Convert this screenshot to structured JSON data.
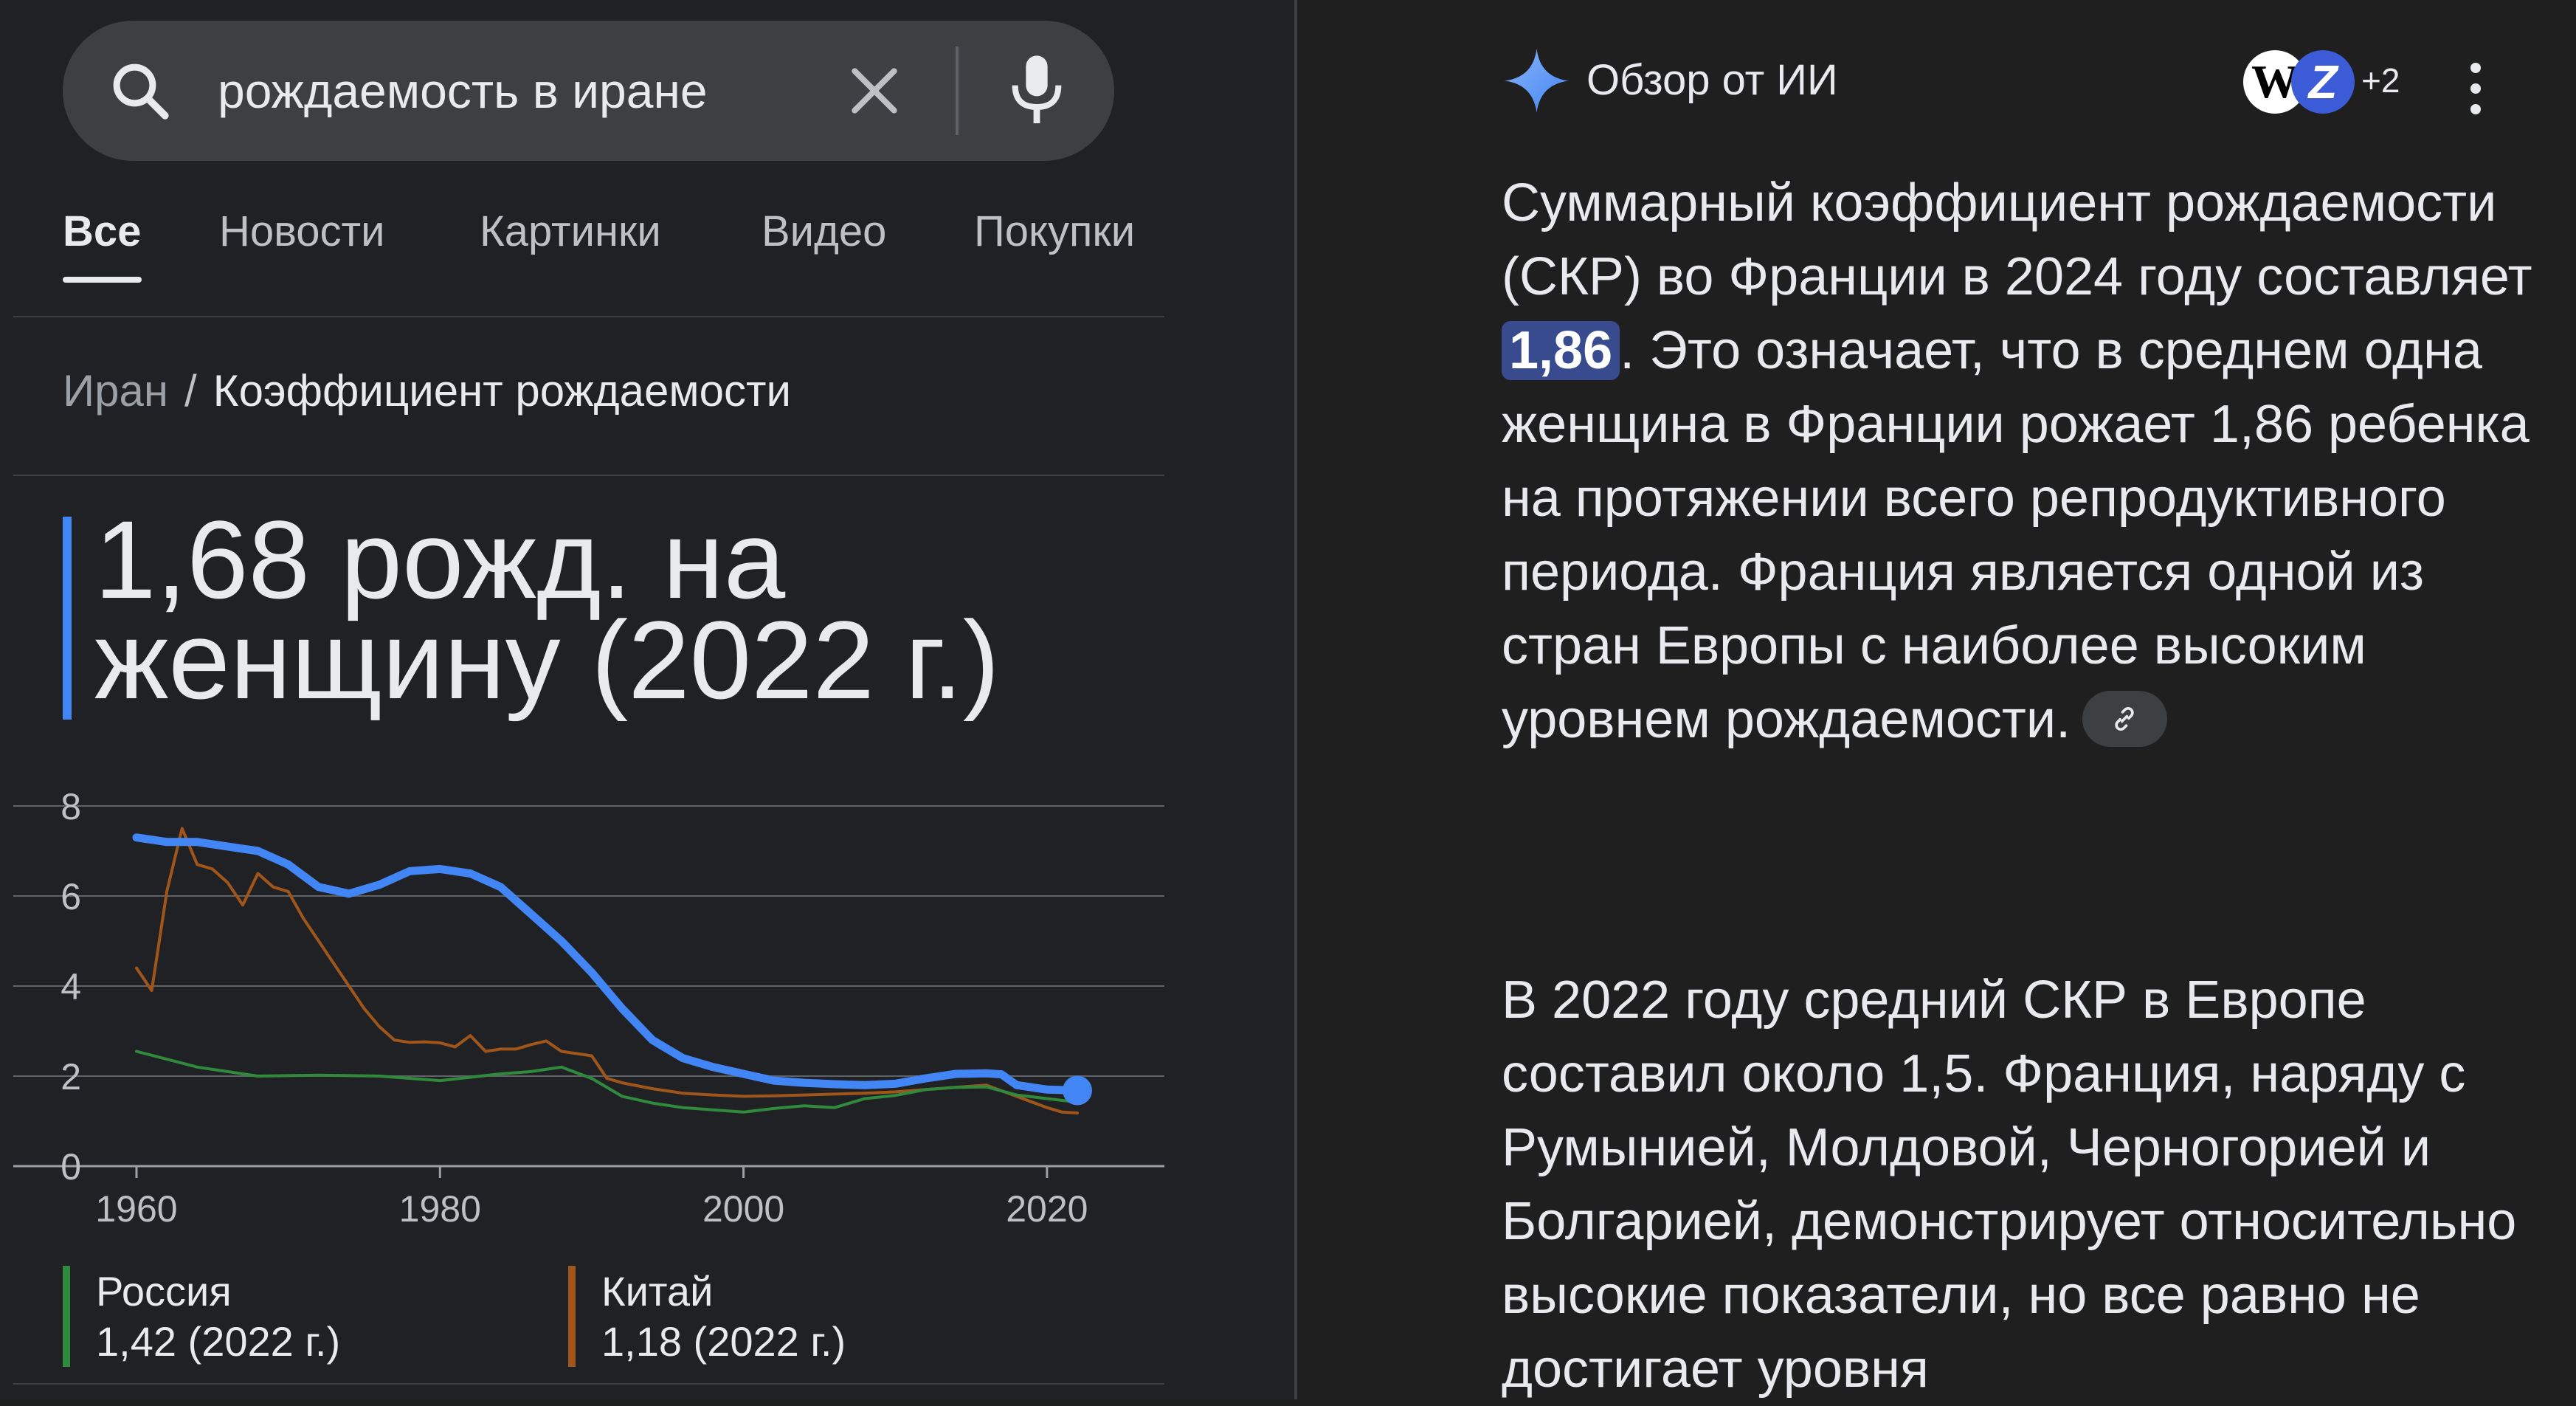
{
  "search": {
    "query": "рождаемость в иране"
  },
  "tabs": [
    "Все",
    "Новости",
    "Картинки",
    "Видео",
    "Покупки"
  ],
  "breadcrumb": {
    "country": "Иран",
    "separator": "/",
    "page": "Коэффициент рождаемости"
  },
  "headline": {
    "value_text": "1,68 рожд. на женщину (2022 г.)"
  },
  "chart_data": {
    "type": "line",
    "x_ticks": [
      "1960",
      "1980",
      "2000",
      "2020"
    ],
    "y_ticks": [
      "0",
      "2",
      "4",
      "6",
      "8"
    ],
    "xlim": [
      1960,
      2022
    ],
    "ylim": [
      0,
      8
    ],
    "grid": true,
    "series": [
      {
        "name": "Иран",
        "color": "#4285f4",
        "highlight": true,
        "x": [
          1960,
          1962,
          1964,
          1966,
          1968,
          1970,
          1972,
          1974,
          1976,
          1978,
          1980,
          1982,
          1984,
          1986,
          1988,
          1990,
          1992,
          1994,
          1996,
          1998,
          2000,
          2002,
          2004,
          2006,
          2008,
          2010,
          2012,
          2014,
          2016,
          2017,
          2018,
          2020,
          2022
        ],
        "y": [
          7.3,
          7.2,
          7.2,
          7.1,
          7.0,
          6.7,
          6.2,
          6.05,
          6.25,
          6.55,
          6.6,
          6.5,
          6.2,
          5.6,
          5.0,
          4.3,
          3.5,
          2.8,
          2.4,
          2.2,
          2.05,
          1.9,
          1.85,
          1.82,
          1.8,
          1.83,
          1.95,
          2.05,
          2.06,
          2.04,
          1.8,
          1.7,
          1.68
        ]
      },
      {
        "name": "Китай",
        "color": "#a0561a",
        "x": [
          1960,
          1961,
          1962,
          1963,
          1964,
          1965,
          1966,
          1967,
          1968,
          1969,
          1970,
          1971,
          1972,
          1973,
          1974,
          1975,
          1976,
          1977,
          1978,
          1979,
          1980,
          1981,
          1982,
          1983,
          1984,
          1985,
          1986,
          1987,
          1988,
          1989,
          1990,
          1991,
          1992,
          1994,
          1996,
          1998,
          2000,
          2002,
          2004,
          2006,
          2008,
          2010,
          2012,
          2014,
          2016,
          2018,
          2020,
          2021,
          2022
        ],
        "y": [
          4.4,
          3.9,
          6.1,
          7.5,
          6.7,
          6.6,
          6.3,
          5.8,
          6.5,
          6.2,
          6.1,
          5.5,
          5.0,
          4.5,
          4.0,
          3.5,
          3.1,
          2.8,
          2.75,
          2.76,
          2.74,
          2.65,
          2.9,
          2.55,
          2.6,
          2.6,
          2.7,
          2.78,
          2.55,
          2.5,
          2.45,
          1.95,
          1.85,
          1.72,
          1.62,
          1.58,
          1.55,
          1.56,
          1.58,
          1.6,
          1.62,
          1.65,
          1.7,
          1.75,
          1.8,
          1.55,
          1.3,
          1.2,
          1.18
        ]
      },
      {
        "name": "Россия",
        "color": "#2f8a3c",
        "x": [
          1960,
          1964,
          1968,
          1972,
          1976,
          1980,
          1984,
          1986,
          1988,
          1990,
          1992,
          1994,
          1996,
          1998,
          2000,
          2002,
          2004,
          2006,
          2008,
          2010,
          2012,
          2014,
          2016,
          2018,
          2020,
          2022
        ],
        "y": [
          2.55,
          2.2,
          2.0,
          2.02,
          2.0,
          1.9,
          2.05,
          2.1,
          2.2,
          1.95,
          1.55,
          1.4,
          1.3,
          1.25,
          1.2,
          1.28,
          1.34,
          1.3,
          1.5,
          1.57,
          1.7,
          1.75,
          1.76,
          1.58,
          1.5,
          1.42
        ]
      }
    ]
  },
  "legend": [
    {
      "name": "Россия",
      "value": "1,42 (2022 г.)",
      "color": "#2f8a3c"
    },
    {
      "name": "Китай",
      "value": "1,18 (2022 г.)",
      "color": "#a0561a"
    }
  ],
  "ai_overview": {
    "title": "Обзор от ИИ",
    "sources_more": "+2",
    "source1_letter": "W",
    "source2_letter": "Z",
    "p1_before": "Суммарный коэффициент рождаемости (СКР) во Франции в 2024 году составляет ",
    "p1_highlight": "1,86",
    "p1_after": ". Это означает, что в среднем одна женщина в Франции рожает 1,86 ребенка на протяжении всего репродуктивного периода. Франция является одной из стран Европы с наиболее высоким уровнем рождаемости.",
    "p2": "В 2022 году средний СКР в Европе составил около 1,5. Франция, наряду с Румынией, Молдовой, Черногорией и Болгарией, демонстрирует относительно высокие показатели, но все равно не достигает уровня"
  }
}
